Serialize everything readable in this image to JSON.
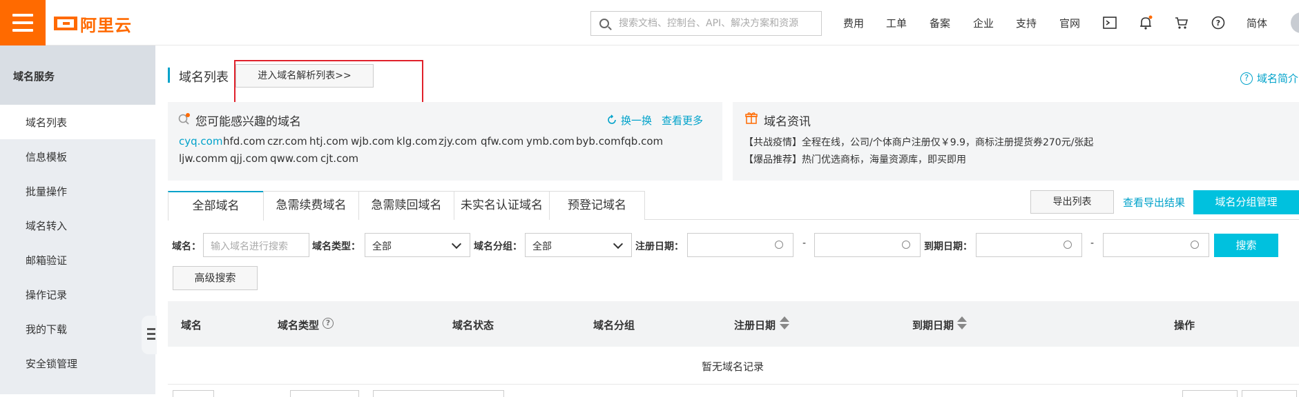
{
  "header": {
    "logo_text": "阿里云",
    "search_placeholder": "搜索文档、控制台、API、解决方案和资源",
    "nav": [
      "费用",
      "工单",
      "备案",
      "企业",
      "支持",
      "官网"
    ],
    "lang": "简体"
  },
  "sidebar": {
    "title": "域名服务",
    "items": [
      {
        "label": "域名列表",
        "active": true
      },
      {
        "label": "信息模板",
        "active": false
      },
      {
        "label": "批量操作",
        "active": false
      },
      {
        "label": "域名转入",
        "active": false
      },
      {
        "label": "邮箱验证",
        "active": false
      },
      {
        "label": "操作记录",
        "active": false
      },
      {
        "label": "我的下载",
        "active": false
      },
      {
        "label": "安全锁管理",
        "active": false
      }
    ]
  },
  "main": {
    "title": "域名列表",
    "dns_button": "进入域名解析列表>>",
    "intro_link": "域名简介",
    "interest": {
      "title": "您可能感兴趣的域名",
      "refresh": "换一换",
      "more": "查看更多",
      "domains": [
        "cyq.com",
        "hfd.com",
        "czr.com",
        "htj.com",
        "wjb.com",
        "klg.com",
        "zjy.com",
        "qfw.com",
        "ymb.com",
        "byb.com",
        "fqb.com",
        "ljw.comm",
        "qjj.com",
        "qww.com",
        "cjt.com"
      ]
    },
    "news": {
      "title": "域名资讯",
      "lines": [
        "【共战疫情】全程在线，公司/个体商户注册仅￥9.9，商标注册提货券270元/张起",
        "【爆品推荐】热门优选商标，海量资源库，即买即用"
      ]
    },
    "tabs": [
      "全部域名",
      "急需续费域名",
      "急需赎回域名",
      "未实名认证域名",
      "预登记域名"
    ],
    "export_button": "导出列表",
    "export_result": "查看导出结果",
    "group_button": "域名分组管理",
    "filters": {
      "domain_label": "域名：",
      "domain_placeholder": "输入域名进行搜索",
      "type_label": "域名类型：",
      "type_value": "全部",
      "group_label": "域名分组：",
      "group_value": "全部",
      "reg_label": "注册日期：",
      "exp_label": "到期日期：",
      "dash": "-",
      "search_button": "搜索",
      "advanced_button": "高级搜索"
    },
    "table": {
      "headers": [
        "域名",
        "域名类型",
        "域名状态",
        "域名分组",
        "注册日期",
        "到期日期",
        "操作"
      ],
      "empty": "暂无域名记录"
    }
  },
  "colors": {
    "brand": "#ff6a00",
    "accent": "#00c1de",
    "link": "#00a2ca",
    "highlight_box": "#e0202a"
  }
}
